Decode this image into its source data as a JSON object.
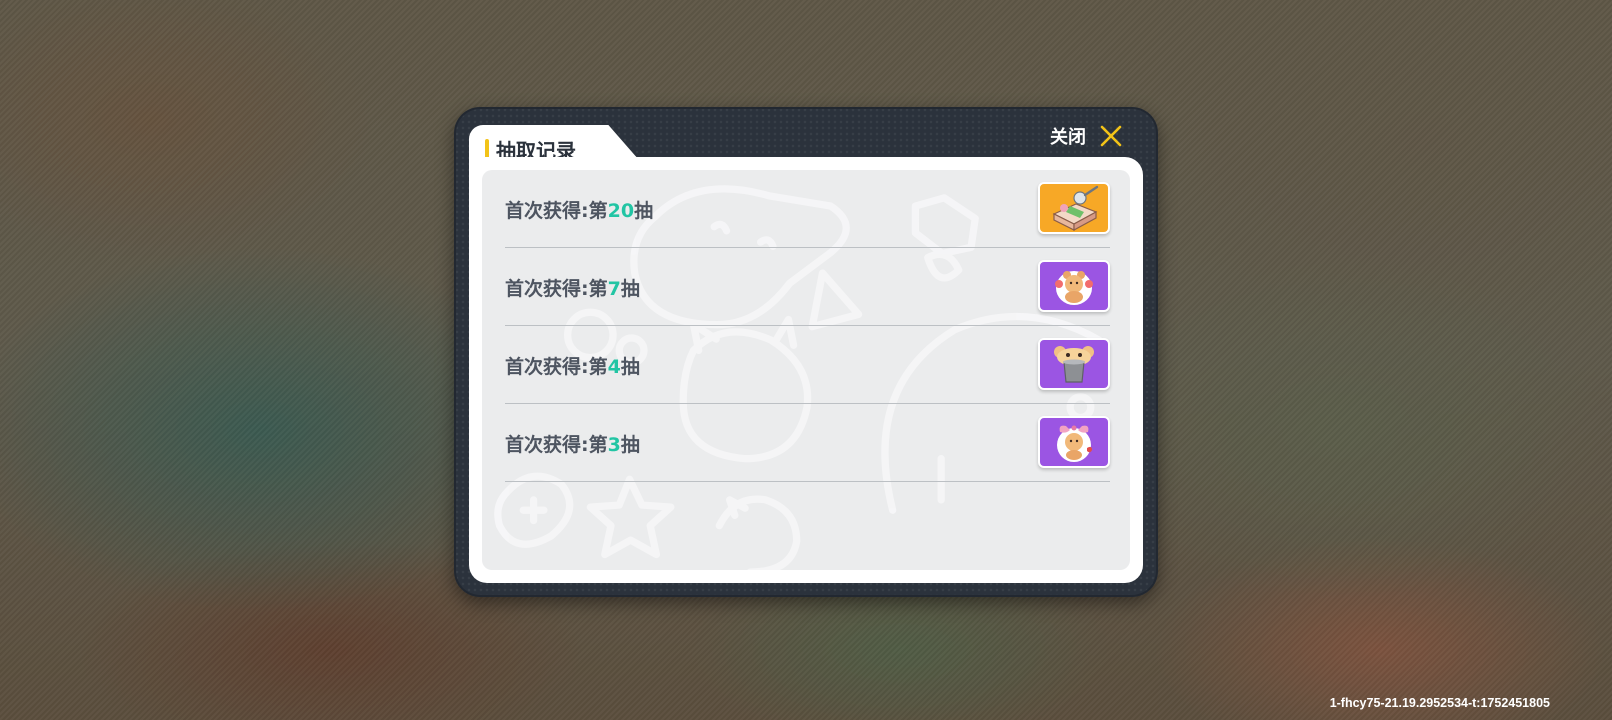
{
  "dialog": {
    "title": "抽取记录",
    "close_label": "关闭",
    "accent_color": "#f2c318",
    "number_color": "#22c5a4",
    "records": [
      {
        "prefix": "首次获得:第",
        "number": "20",
        "suffix": "抽",
        "icon": "gift-box-icon",
        "rarity_color": "#f7a826"
      },
      {
        "prefix": "首次获得:第",
        "number": "7",
        "suffix": "抽",
        "icon": "bear-balloon-icon",
        "rarity_color": "#9b55e3"
      },
      {
        "prefix": "首次获得:第",
        "number": "4",
        "suffix": "抽",
        "icon": "bear-trashcan-icon",
        "rarity_color": "#9b55e3"
      },
      {
        "prefix": "首次获得:第",
        "number": "3",
        "suffix": "抽",
        "icon": "bear-bow-icon",
        "rarity_color": "#9b55e3"
      }
    ]
  },
  "build_id": "1-fhcy75-21.19.2952534-t:1752451805"
}
